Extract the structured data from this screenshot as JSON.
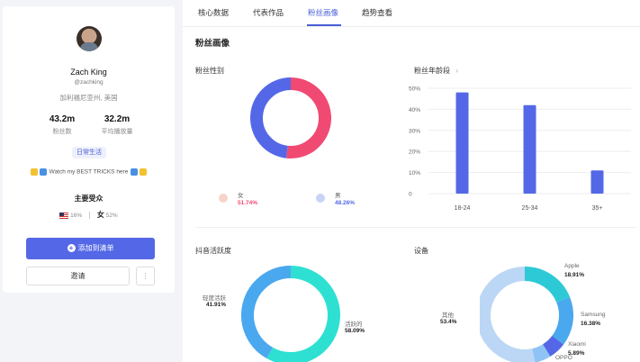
{
  "profile": {
    "name": "Zach King",
    "handle": "@zachking",
    "location": "加利福尼亚州, 美国",
    "followers_value": "43.2m",
    "followers_label": "粉丝数",
    "avg_plays_value": "32.2m",
    "avg_plays_label": "平均播放量",
    "tag": "日常生活",
    "bio": "Watch my BEST TRICKS here",
    "audience_title": "主要受众",
    "audience_country_pct": "16%",
    "audience_gender": "女",
    "audience_gender_pct": "52%",
    "add_button": "添加到清单",
    "invite_button": "邀请",
    "more_button": "⋮"
  },
  "tabs": [
    {
      "label": "核心数据"
    },
    {
      "label": "代表作品"
    },
    {
      "label": "粉丝画像"
    },
    {
      "label": "趋势查看"
    }
  ],
  "active_tab": "粉丝画像",
  "section_title": "粉丝画像",
  "gender": {
    "title": "粉丝性别",
    "female_label": "女",
    "female_pct": "51.74%",
    "male_label": "男",
    "male_pct": "48.26%",
    "colors": {
      "female": "#f04a73",
      "male": "#5468e7"
    }
  },
  "age": {
    "title": "粉丝年龄段",
    "chevron": "›"
  },
  "activity": {
    "title": "抖音活跃度",
    "light_label": "轻度活跃",
    "light_pct": "41.91%",
    "active_label": "活跃的",
    "active_pct": "58.09%",
    "colors": {
      "active": "#2ee0d2",
      "light": "#4aa8ef"
    }
  },
  "devices": {
    "title": "设备",
    "items": [
      {
        "label": "Apple",
        "pct": "18.91%",
        "value": 18.91,
        "color": "#2ec9d6"
      },
      {
        "label": "Samsung",
        "pct": "16.38%",
        "value": 16.38,
        "color": "#4aa8ef"
      },
      {
        "label": "Xiaomi",
        "pct": "5.89%",
        "value": 5.89,
        "color": "#5468e7"
      },
      {
        "label": "OPPO",
        "pct": "",
        "value": 5.4,
        "color": "#8fc3f5"
      },
      {
        "label": "其他",
        "pct": "53.4%",
        "value": 53.4,
        "color": "#bcd7f5"
      }
    ]
  },
  "chart_data": [
    {
      "type": "pie",
      "title": "粉丝性别",
      "categories": [
        "女",
        "男"
      ],
      "values": [
        51.74,
        48.26
      ]
    },
    {
      "type": "bar",
      "title": "粉丝年龄段",
      "categories": [
        "18-24",
        "25-34",
        "35+"
      ],
      "values": [
        48,
        42,
        11
      ],
      "ylim": [
        0,
        50
      ],
      "yticks": [
        "50%",
        "40%",
        "30%",
        "20%",
        "10%",
        "0"
      ],
      "color": "#5468e7",
      "grid": true
    },
    {
      "type": "pie",
      "title": "抖音活跃度",
      "categories": [
        "轻度活跃",
        "活跃的"
      ],
      "values": [
        41.91,
        58.09
      ]
    },
    {
      "type": "pie",
      "title": "设备",
      "categories": [
        "Apple",
        "Samsung",
        "Xiaomi",
        "OPPO",
        "其他"
      ],
      "values": [
        18.91,
        16.38,
        5.89,
        5.4,
        53.4
      ]
    }
  ]
}
